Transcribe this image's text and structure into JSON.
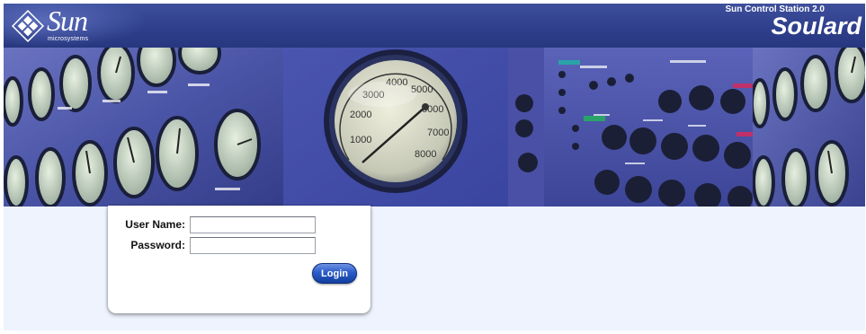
{
  "header": {
    "logo_word": "Sun",
    "logo_sub": "microsystems",
    "product_name": "Sun Control Station 2.0",
    "server_name": "Soulard"
  },
  "banner": {
    "gauge_ticks": [
      "1000",
      "2000",
      "3000",
      "4000",
      "5000",
      "6000",
      "7000",
      "8000"
    ]
  },
  "login": {
    "username_label": "User Name:",
    "password_label": "Password:",
    "username_value": "",
    "password_value": "",
    "login_button": "Login"
  },
  "colors": {
    "header_blue": "#2f3f8c",
    "banner_blue": "#4a52a0",
    "content_bg": "#eef3fd",
    "button_blue": "#2a5bc9"
  }
}
